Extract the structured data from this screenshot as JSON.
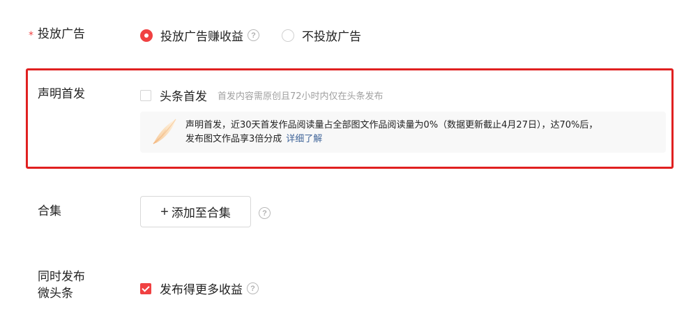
{
  "ads": {
    "label": "投放广告",
    "required_mark": "*",
    "options": [
      {
        "label": "投放广告赚收益",
        "selected": true,
        "help_icon": "question-circle-icon"
      },
      {
        "label": "不投放广告",
        "selected": false
      }
    ]
  },
  "declare_first": {
    "label": "声明首发",
    "checkbox_label": "头条首发",
    "checked": false,
    "hint": "首发内容需原创且72小时内仅在头条发布",
    "notice": {
      "icon": "feather-icon",
      "line1": "声明首发，近30天首发作品阅读量占全部图文作品阅读量为0%（数据更新截止4月27日），达70%后，",
      "line2": "发布图文作品享3倍分成",
      "link": "详细了解"
    }
  },
  "collection": {
    "label": "合集",
    "button_icon": "plus-icon",
    "button_plus": "+",
    "button_label": "添加至合集",
    "help_icon": "question-circle-icon"
  },
  "micro": {
    "label_line1": "同时发布",
    "label_line2": "微头条",
    "checkbox_label": "发布得更多收益",
    "checked": true,
    "help_icon": "question-circle-icon"
  },
  "help_glyph": "?",
  "colors": {
    "accent": "#f04142",
    "highlight_border": "#e02020",
    "link": "#406599",
    "hint": "#a0a0a0"
  }
}
